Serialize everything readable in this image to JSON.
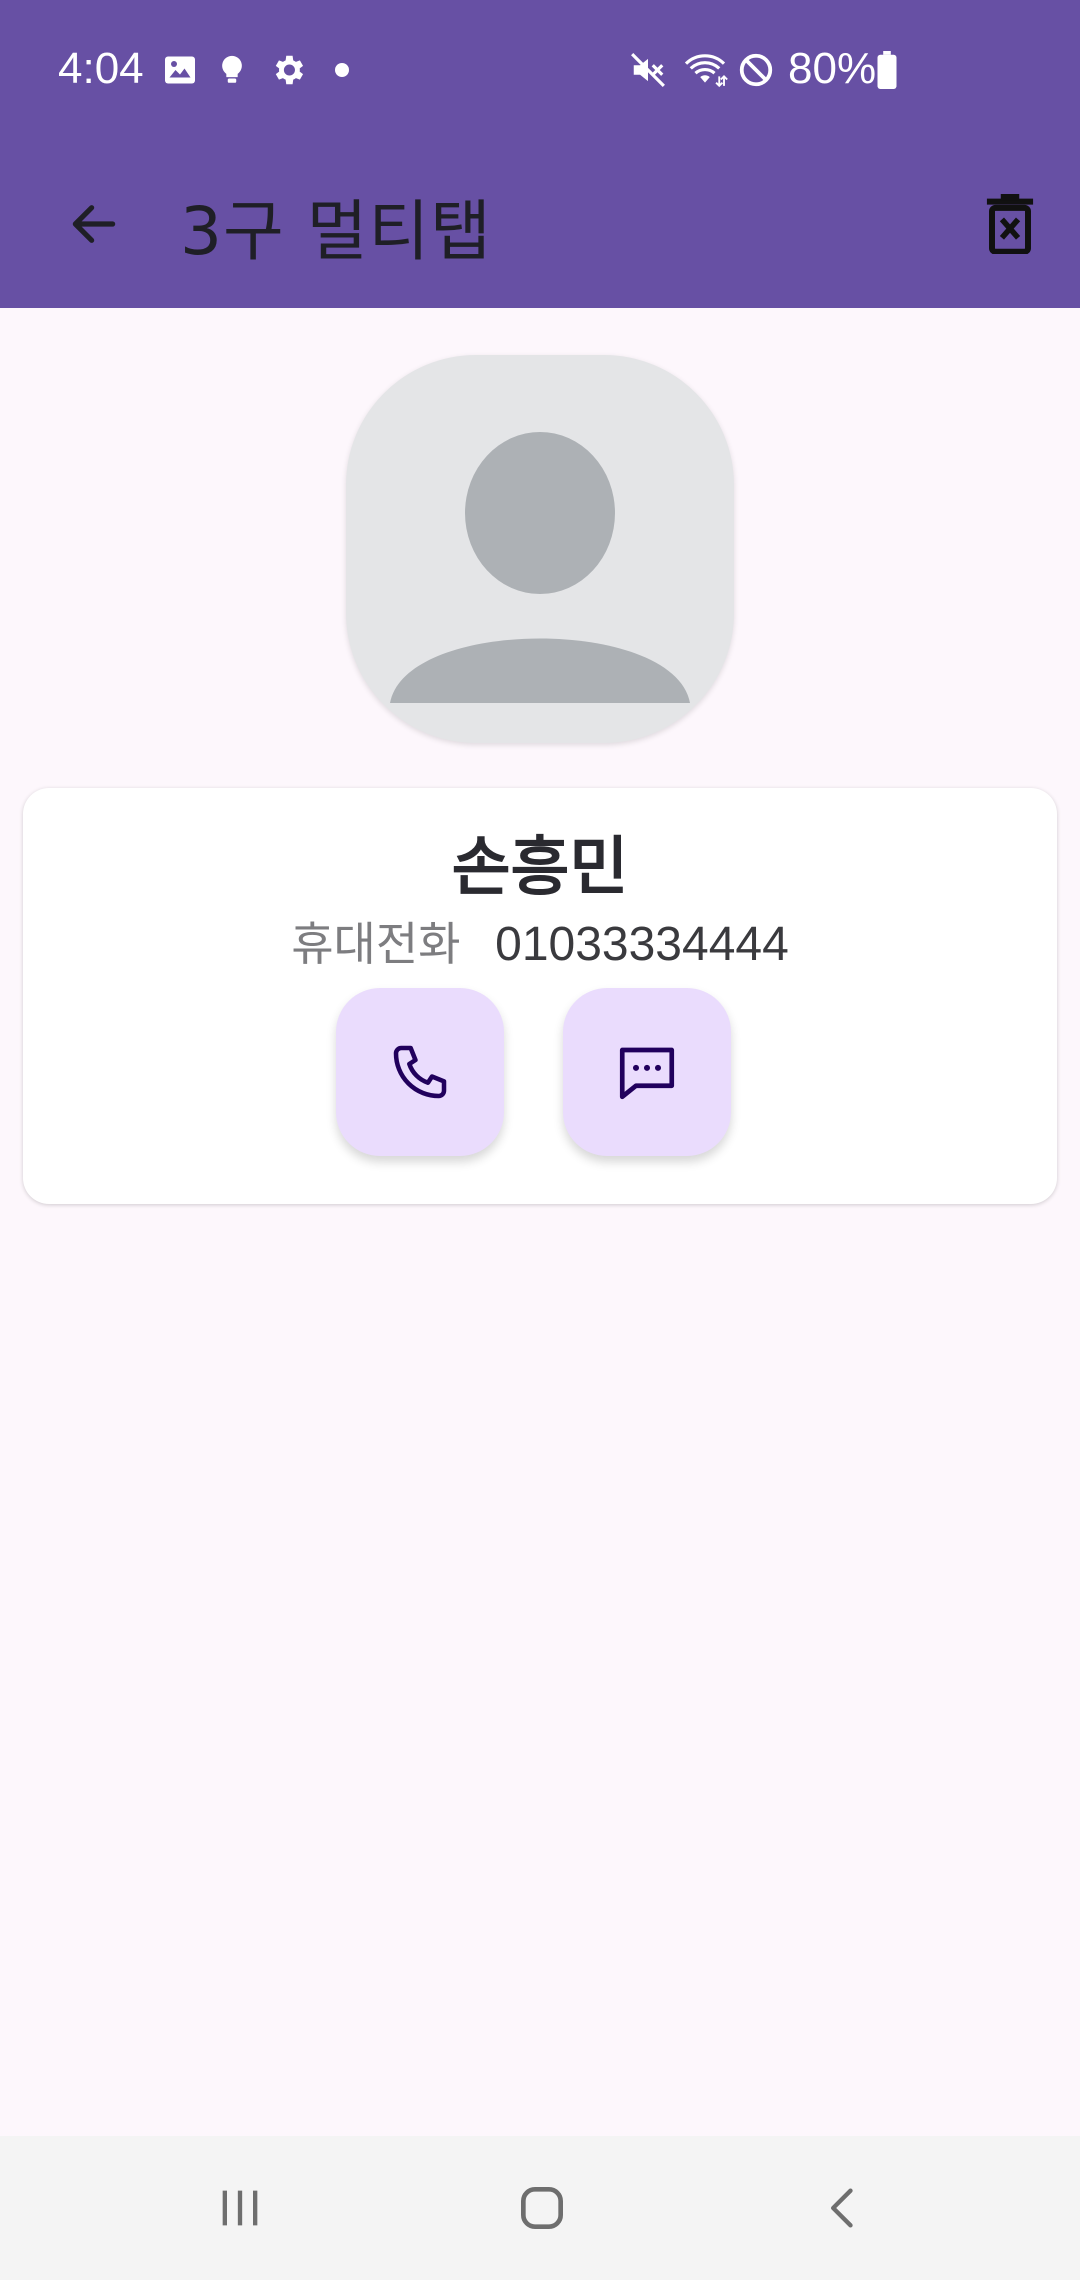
{
  "status_bar": {
    "time": "4:04",
    "battery": "80%",
    "icons": [
      "gallery-icon",
      "bulb-icon",
      "settings-icon",
      "dot-icon",
      "mute-icon",
      "wifi-icon",
      "dnd-icon",
      "battery-icon"
    ]
  },
  "app_bar": {
    "title": "3구 멀티탭",
    "back_icon": "arrow-back-icon",
    "delete_icon": "delete-icon"
  },
  "contact": {
    "name": "손흥민",
    "phone_label": "휴대전화",
    "phone_number": "01033334444"
  },
  "actions": [
    {
      "name": "call",
      "icon": "phone-icon"
    },
    {
      "name": "message",
      "icon": "message-icon"
    }
  ],
  "colors": {
    "primary": "#6750a4",
    "background": "#fdf7fc",
    "action_button": "#eadcfd",
    "icon_dark": "#21005d"
  },
  "nav_bar": [
    "recents-icon",
    "home-icon",
    "back-icon"
  ]
}
